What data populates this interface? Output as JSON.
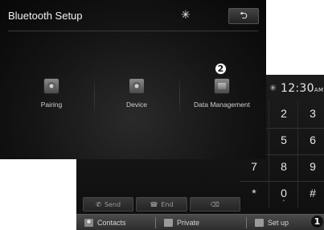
{
  "setup_screen": {
    "title": "Bluetooth Setup",
    "bluetooth_icon": "bluetooth-icon",
    "back_icon": "return-arrow-icon",
    "menu": [
      {
        "label": "Pairing",
        "icon": "pairing-icon"
      },
      {
        "label": "Device",
        "icon": "device-icon"
      },
      {
        "label": "Data Management",
        "icon": "folder-icon"
      }
    ]
  },
  "phone_screen": {
    "time": "12:30",
    "ampm": "AM",
    "keypad": {
      "col1": [
        "",
        "",
        "7",
        "*"
      ],
      "col2": [
        "2",
        "5",
        "8",
        "0"
      ],
      "col3": [
        "3",
        "6",
        "9",
        "#"
      ],
      "zero_sub": "+"
    },
    "call_buttons": {
      "send": "Send",
      "end": "End",
      "delete_icon": "backspace-icon"
    },
    "tabs": {
      "contacts": "Contacts",
      "private": "Private",
      "setup": "Set up"
    }
  },
  "callouts": {
    "marker_1": "1",
    "marker_2": "2"
  }
}
